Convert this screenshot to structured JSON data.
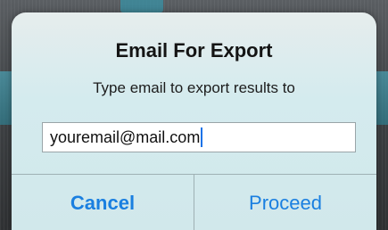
{
  "dialog": {
    "title": "Email For Export",
    "message": "Type email to export results to",
    "email_value": "youremail@mail.com",
    "cancel_label": "Cancel",
    "proceed_label": "Proceed"
  },
  "colors": {
    "accent": "#1a7fe0",
    "dialog_background": "#d4ebee",
    "caret": "#1a73e8"
  }
}
